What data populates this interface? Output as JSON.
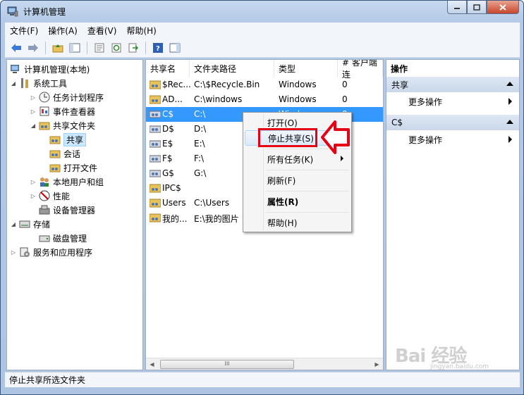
{
  "window": {
    "title": "计算机管理"
  },
  "menubar": [
    "文件(F)",
    "操作(A)",
    "查看(V)",
    "帮助(H)"
  ],
  "tree": {
    "root": "计算机管理(本地)",
    "system_tools": "系统工具",
    "task_scheduler": "任务计划程序",
    "event_viewer": "事件查看器",
    "shared_folders": "共享文件夹",
    "shares": "共享",
    "sessions": "会话",
    "open_files": "打开文件",
    "local_users": "本地用户和组",
    "performance": "性能",
    "device_manager": "设备管理器",
    "storage": "存储",
    "disk_management": "磁盘管理",
    "services_apps": "服务和应用程序"
  },
  "table": {
    "columns": [
      "共享名",
      "文件夹路径",
      "类型",
      "# 客户端连"
    ],
    "rows": [
      {
        "name": "$Rec...",
        "path": "C:\\$Recycle.Bin",
        "type": "Windows",
        "clients": "0"
      },
      {
        "name": "AD...",
        "path": "C:\\windows",
        "type": "Windows",
        "clients": "0"
      },
      {
        "name": "C$",
        "path": "C:\\",
        "type": "Windows",
        "clients": "0"
      },
      {
        "name": "D$",
        "path": "D:\\",
        "type": "",
        "clients": ""
      },
      {
        "name": "E$",
        "path": "E:\\",
        "type": "",
        "clients": ""
      },
      {
        "name": "F$",
        "path": "F:\\",
        "type": "",
        "clients": ""
      },
      {
        "name": "G$",
        "path": "G:\\",
        "type": "",
        "clients": ""
      },
      {
        "name": "IPC$",
        "path": "",
        "type": "",
        "clients": ""
      },
      {
        "name": "Users",
        "path": "C:\\Users",
        "type": "",
        "clients": ""
      },
      {
        "name": "我的...",
        "path": "E:\\我的图片",
        "type": "",
        "clients": ""
      }
    ],
    "scroll_thumb": "III"
  },
  "context_menu": {
    "open": "打开(O)",
    "stop_sharing": "停止共享(S)",
    "all_tasks": "所有任务(K)",
    "refresh": "刷新(F)",
    "properties": "属性(R)",
    "help": "帮助(H)"
  },
  "actions": {
    "header": "操作",
    "section1": "共享",
    "section1_more": "更多操作",
    "section2": "C$",
    "section2_more": "更多操作"
  },
  "status": "停止共享所选文件夹",
  "watermark": {
    "main": "Bai 经验",
    "sub": "jingyan.baidu.com"
  },
  "colors": {
    "selection": "#3399ff",
    "highlight": "#e60012",
    "frame": "#b3c9e6"
  }
}
